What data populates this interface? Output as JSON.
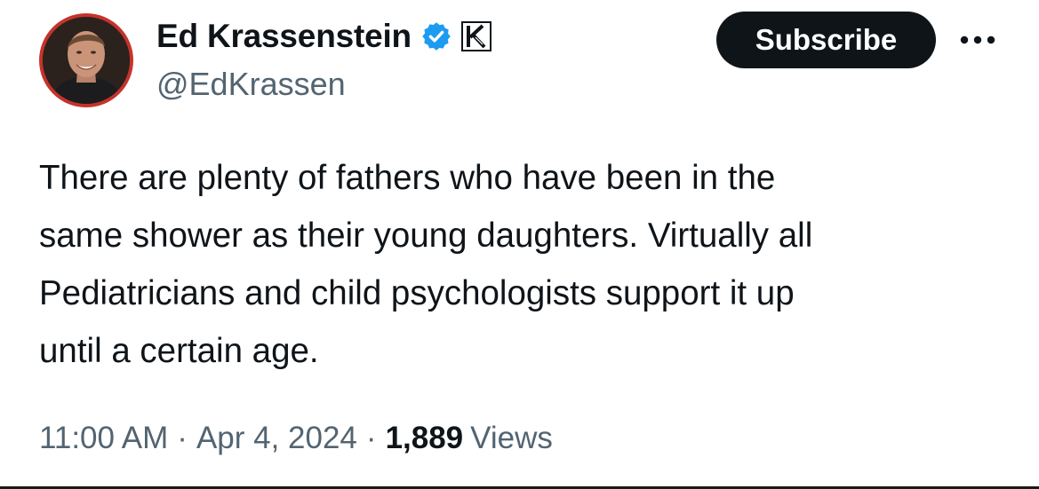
{
  "author": {
    "display_name": "Ed Krassenstein",
    "handle": "@EdKrassen",
    "verified_badge": "verified-check-icon",
    "affiliate_badge": "k-logo-badge"
  },
  "actions": {
    "subscribe_label": "Subscribe",
    "more_icon": "more-horizontal-icon"
  },
  "tweet": {
    "text_lines": [
      "There are plenty of fathers who have been in the",
      "same shower as their young daughters.  Virtually all",
      "Pediatricians and child psychologists support it up",
      "until a certain age."
    ]
  },
  "meta": {
    "time": "11:00 AM",
    "separator": "·",
    "date": "Apr 4, 2024",
    "views_count": "1,889",
    "views_label": "Views"
  },
  "colors": {
    "text_primary": "#0f1419",
    "text_secondary": "#536471",
    "verified_blue": "#1d9bf0",
    "button_bg": "#0f1419",
    "avatar_ring": "#c5332b"
  }
}
